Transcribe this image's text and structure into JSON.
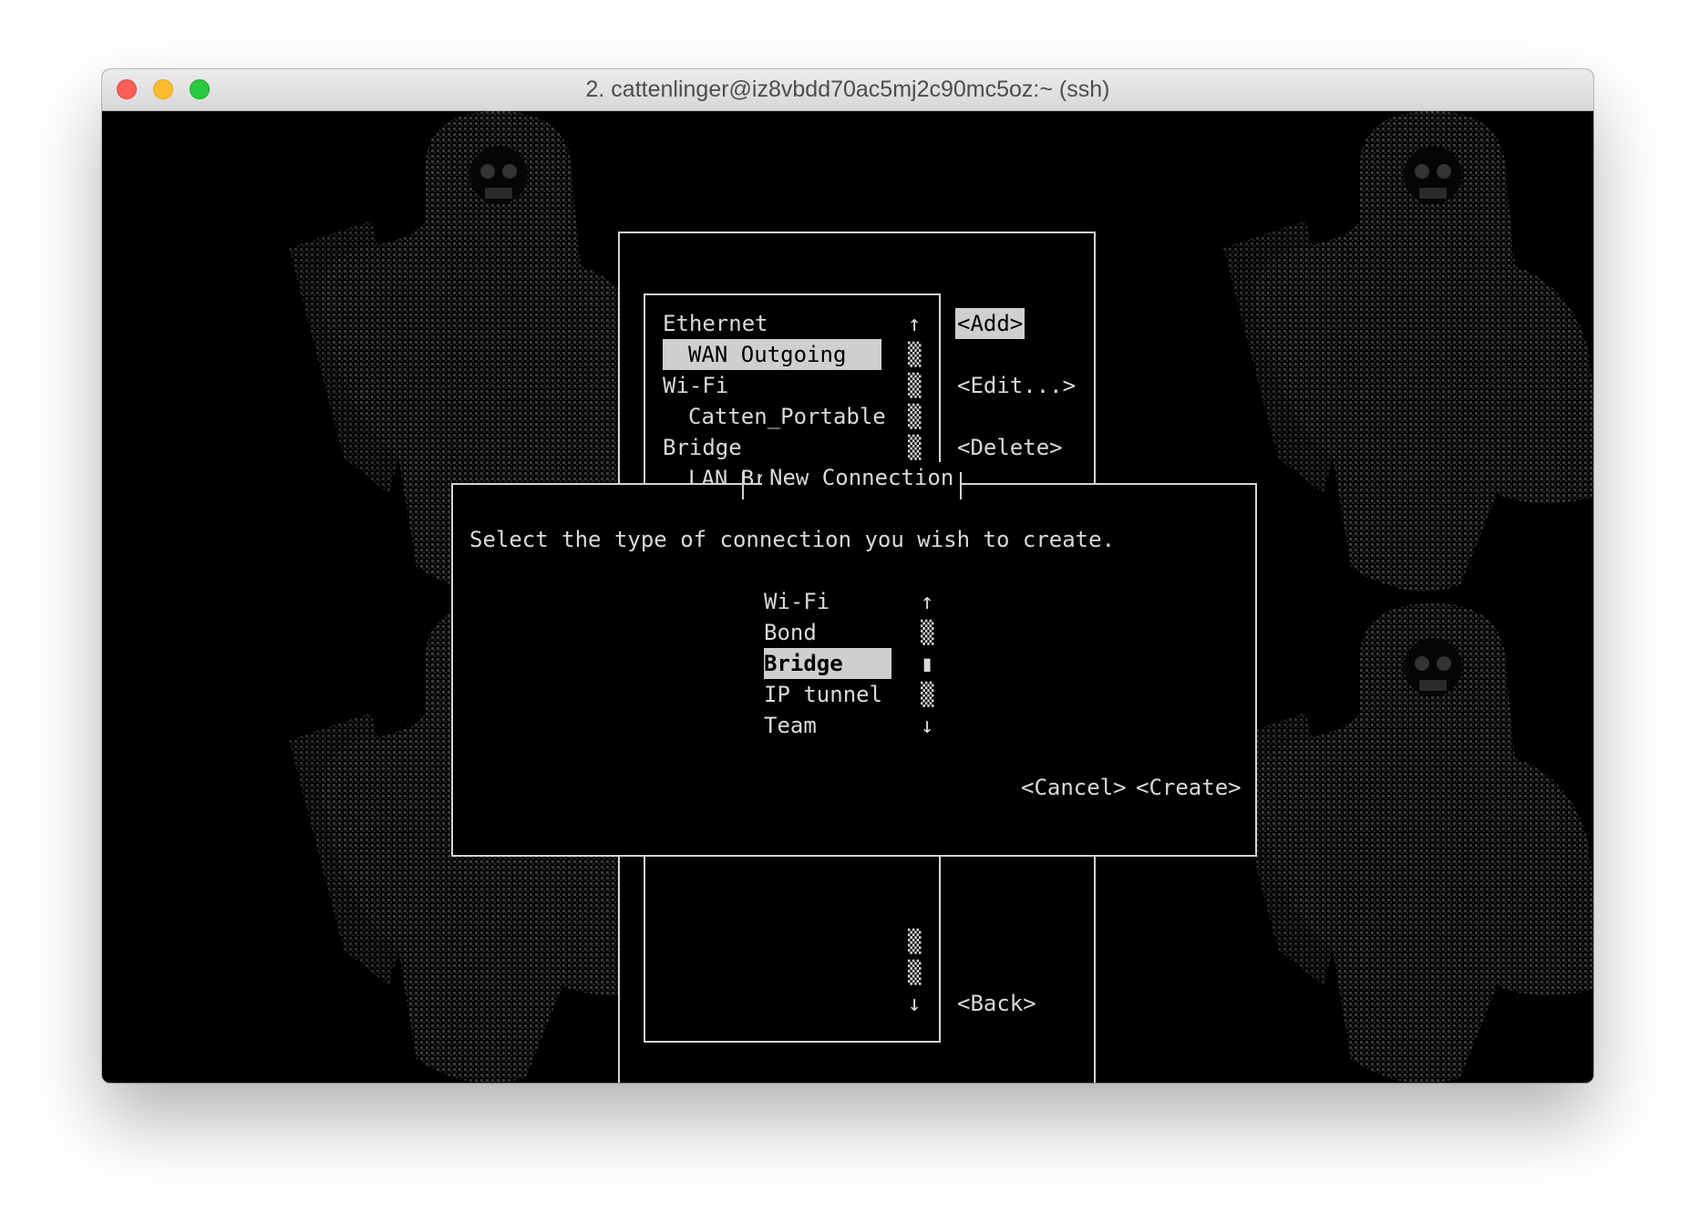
{
  "window": {
    "title": "2. cattenlinger@iz8vbdd70ac5mj2c90mc5oz:~ (ssh)"
  },
  "connections_list": {
    "items": [
      {
        "label": "Ethernet",
        "indent": false,
        "scroll": "↑"
      },
      {
        "label": "WAN Outgoing",
        "indent": true,
        "scroll": "▒"
      },
      {
        "label": "Wi-Fi",
        "indent": false,
        "scroll": "▒"
      },
      {
        "label": "Catten_Portable",
        "indent": true,
        "scroll": "▒"
      },
      {
        "label": "Bridge",
        "indent": false,
        "scroll": "▒"
      },
      {
        "label": "LAN Bridge",
        "indent": true,
        "scroll": "▒"
      }
    ],
    "selected": "WAN Outgoing",
    "lower_scroll": [
      "▒",
      "▒",
      "↓"
    ]
  },
  "actions": {
    "add": "<Add>",
    "edit": "<Edit...>",
    "delete": "<Delete>",
    "back": "<Back>"
  },
  "dialog": {
    "title": "New Connection",
    "prompt": "Select the type of connection you wish to create.",
    "types": [
      {
        "label": "Wi-Fi",
        "scroll": "↑"
      },
      {
        "label": "Bond",
        "scroll": "▒"
      },
      {
        "label": "Bridge",
        "scroll": "▮"
      },
      {
        "label": "IP tunnel",
        "scroll": "▒"
      },
      {
        "label": "Team",
        "scroll": "↓"
      }
    ],
    "selected_type": "Bridge",
    "cancel": "<Cancel>",
    "create": "<Create>"
  },
  "colors": {
    "terminal_bg": "#000000",
    "text": "#d9d9d9",
    "highlight": "#cfcfcf",
    "close": "#fe5f57",
    "minimize": "#febc2e",
    "maximize": "#28c840"
  }
}
